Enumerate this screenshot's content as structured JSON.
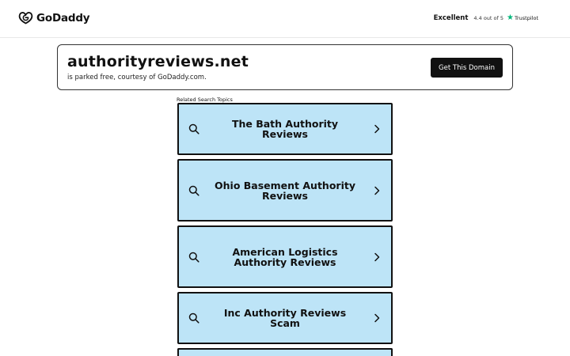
{
  "header": {
    "brand": "GoDaddy",
    "rating_word": "Excellent",
    "rating_score": "4.4 out of 5",
    "trustpilot_label": "Trustpilot"
  },
  "domain": {
    "name": "authorityreviews.net",
    "subtitle": "is parked free, courtesy of GoDaddy.com.",
    "button_label": "Get This Domain"
  },
  "related": {
    "label": "Related Search Topics",
    "items": [
      {
        "label": "The Bath Authority Reviews"
      },
      {
        "label": "Ohio Basement Authority Reviews"
      },
      {
        "label": "American Logistics Authority Reviews"
      },
      {
        "label": "Inc Authority Reviews Scam"
      },
      {
        "label": ""
      }
    ]
  },
  "colors": {
    "result_bg": "#bde4f7",
    "button_bg": "#111111",
    "trustpilot_star": "#00b67a"
  },
  "icons": {
    "logo": "godaddy-logo-icon",
    "search": "search-icon",
    "chevron": "chevron-right-icon",
    "star": "trustpilot-star-icon"
  }
}
